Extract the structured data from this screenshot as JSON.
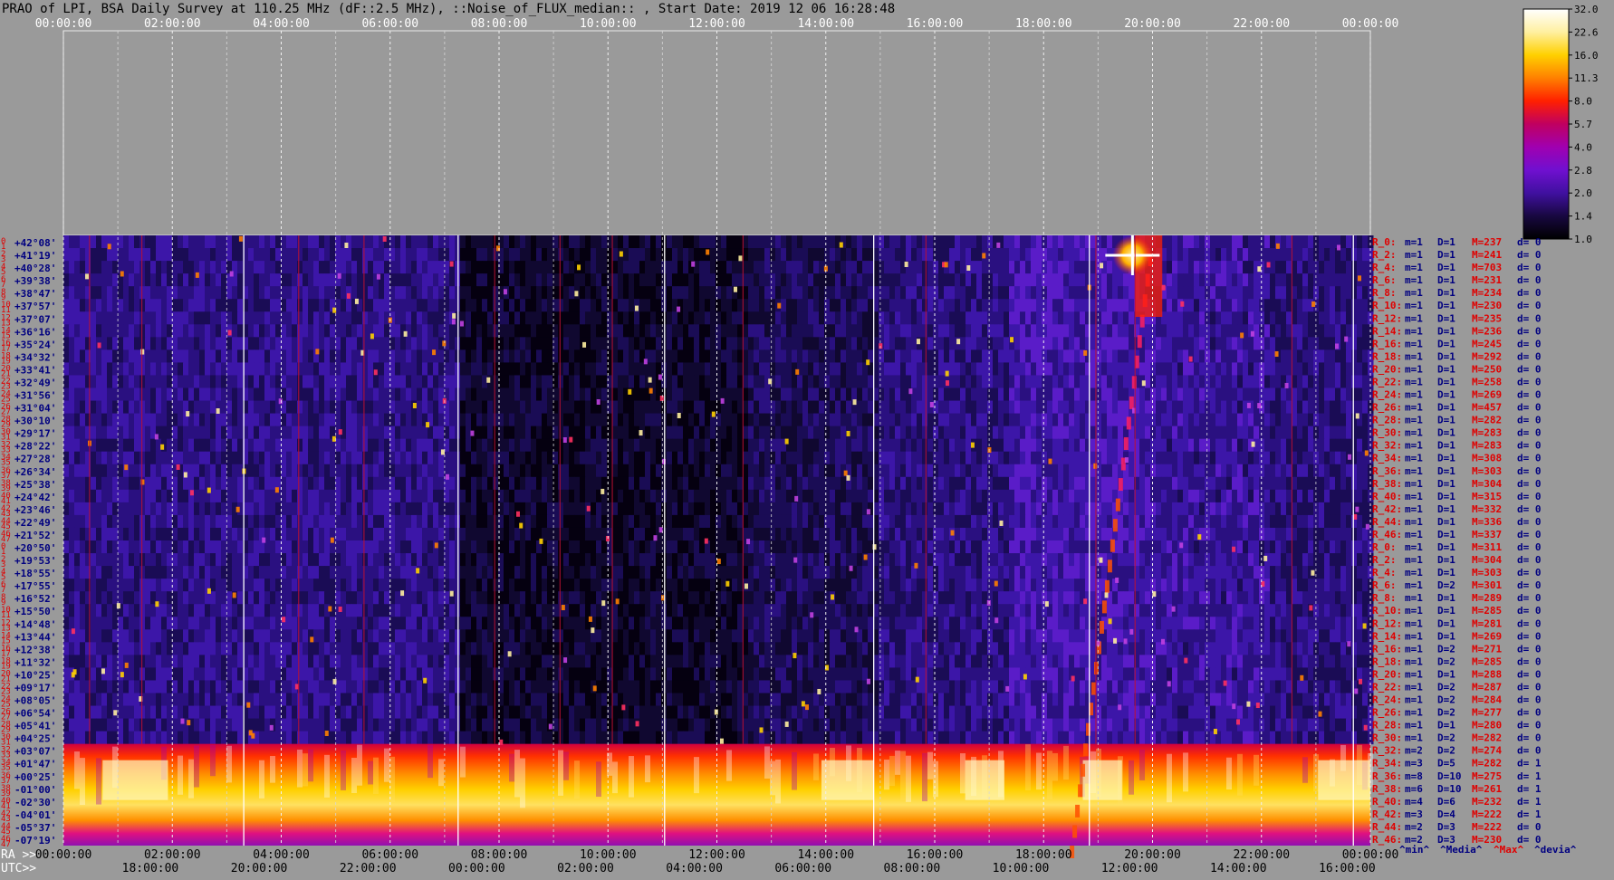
{
  "title": "PRAO of LPI, BSA Daily Survey at 110.25 MHz (dF::2.5 MHz), ::Noise_of_FLUX_median:: , Start Date: 2019 12 06 16:28:48",
  "chart_data": {
    "type": "heatmap",
    "title": "PRAO of LPI, BSA Daily Survey at 110.25 MHz (dF::2.5 MHz), ::Noise_of_FLUX_median:: , Start Date: 2019 12 06 16:28:48",
    "x_axis_top": {
      "ticks": [
        "00:00:00",
        "02:00:00",
        "04:00:00",
        "06:00:00",
        "08:00:00",
        "10:00:00",
        "12:00:00",
        "14:00:00",
        "16:00:00",
        "18:00:00",
        "20:00:00",
        "22:00:00",
        "00:00:00"
      ]
    },
    "x_axis_bottom_ra": {
      "prefix": "RA >>",
      "ticks": [
        "00:00:00",
        "02:00:00",
        "04:00:00",
        "06:00:00",
        "08:00:00",
        "10:00:00",
        "12:00:00",
        "14:00:00",
        "16:00:00",
        "18:00:00",
        "20:00:00",
        "22:00:00",
        "00:00:00"
      ]
    },
    "x_axis_bottom_utc": {
      "prefix": "UTC>>",
      "ticks": [
        "18:00:00",
        "20:00:00",
        "22:00:00",
        "00:00:00",
        "02:00:00",
        "04:00:00",
        "06:00:00",
        "08:00:00",
        "10:00:00",
        "12:00:00",
        "14:00:00",
        "16:00:00"
      ]
    },
    "beam_numbers": [
      "0",
      "1",
      "2",
      "3",
      "4",
      "5",
      "6",
      "7",
      "8",
      "9",
      "10",
      "11",
      "12",
      "13",
      "14",
      "15",
      "16",
      "17",
      "18",
      "19",
      "20",
      "21",
      "22",
      "23",
      "24",
      "25",
      "26",
      "27",
      "28",
      "29",
      "30",
      "31",
      "32",
      "33",
      "34",
      "35",
      "36",
      "37",
      "38",
      "39",
      "40",
      "41",
      "42",
      "43",
      "44",
      "45",
      "46",
      "47",
      "0",
      "1",
      "2",
      "3",
      "4",
      "5",
      "6",
      "7",
      "8",
      "9",
      "10",
      "11",
      "12",
      "13",
      "14",
      "15",
      "16",
      "17",
      "18",
      "19",
      "20",
      "21",
      "22",
      "23",
      "24",
      "25",
      "26",
      "27",
      "28",
      "29",
      "30",
      "31",
      "32",
      "33",
      "34",
      "35",
      "36",
      "37",
      "38",
      "39",
      "40",
      "41",
      "42",
      "43",
      "44",
      "45",
      "46",
      "47"
    ],
    "declinations": [
      "+42°08'",
      "+41°19'",
      "+40°28'",
      "+39°38'",
      "+38°47'",
      "+37°57'",
      "+37°07'",
      "+36°16'",
      "+35°24'",
      "+34°32'",
      "+33°41'",
      "+32°49'",
      "+31°56'",
      "+31°04'",
      "+30°10'",
      "+29°17'",
      "+28°22'",
      "+27°28'",
      "+26°34'",
      "+25°38'",
      "+24°42'",
      "+23°46'",
      "+22°49'",
      "+21°52'",
      "+20°50'",
      "+19°53'",
      "+18°55'",
      "+17°55'",
      "+16°52'",
      "+15°50'",
      "+14°48'",
      "+13°44'",
      "+12°38'",
      "+11°32'",
      "+10°25'",
      "+09°17'",
      "+08°05'",
      "+06°54'",
      "+05°41'",
      "+04°25'",
      "+03°07'",
      "+01°47'",
      "+00°25'",
      "-01°00'",
      "-02°30'",
      "-04°01'",
      "-05°37'",
      "-07°19'"
    ],
    "right_stats": [
      {
        "r": "R_0:",
        "m": "m=1",
        "d": "D=1",
        "M": "M=237",
        "dd": "d= 0"
      },
      {
        "r": "R_2:",
        "m": "m=1",
        "d": "D=1",
        "M": "M=241",
        "dd": "d= 0"
      },
      {
        "r": "R_4:",
        "m": "m=1",
        "d": "D=1",
        "M": "M=703",
        "dd": "d= 0"
      },
      {
        "r": "R_6:",
        "m": "m=1",
        "d": "D=1",
        "M": "M=231",
        "dd": "d= 0"
      },
      {
        "r": "R_8:",
        "m": "m=1",
        "d": "D=1",
        "M": "M=234",
        "dd": "d= 0"
      },
      {
        "r": "R_10:",
        "m": "m=1",
        "d": "D=1",
        "M": "M=230",
        "dd": "d= 0"
      },
      {
        "r": "R_12:",
        "m": "m=1",
        "d": "D=1",
        "M": "M=235",
        "dd": "d= 0"
      },
      {
        "r": "R_14:",
        "m": "m=1",
        "d": "D=1",
        "M": "M=236",
        "dd": "d= 0"
      },
      {
        "r": "R_16:",
        "m": "m=1",
        "d": "D=1",
        "M": "M=245",
        "dd": "d= 0"
      },
      {
        "r": "R_18:",
        "m": "m=1",
        "d": "D=1",
        "M": "M=292",
        "dd": "d= 0"
      },
      {
        "r": "R_20:",
        "m": "m=1",
        "d": "D=1",
        "M": "M=250",
        "dd": "d= 0"
      },
      {
        "r": "R_22:",
        "m": "m=1",
        "d": "D=1",
        "M": "M=258",
        "dd": "d= 0"
      },
      {
        "r": "R_24:",
        "m": "m=1",
        "d": "D=1",
        "M": "M=269",
        "dd": "d= 0"
      },
      {
        "r": "R_26:",
        "m": "m=1",
        "d": "D=1",
        "M": "M=457",
        "dd": "d= 0"
      },
      {
        "r": "R_28:",
        "m": "m=1",
        "d": "D=1",
        "M": "M=282",
        "dd": "d= 0"
      },
      {
        "r": "R_30:",
        "m": "m=1",
        "d": "D=1",
        "M": "M=283",
        "dd": "d= 0"
      },
      {
        "r": "R_32:",
        "m": "m=1",
        "d": "D=1",
        "M": "M=283",
        "dd": "d= 0"
      },
      {
        "r": "R_34:",
        "m": "m=1",
        "d": "D=1",
        "M": "M=308",
        "dd": "d= 0"
      },
      {
        "r": "R_36:",
        "m": "m=1",
        "d": "D=1",
        "M": "M=303",
        "dd": "d= 0"
      },
      {
        "r": "R_38:",
        "m": "m=1",
        "d": "D=1",
        "M": "M=304",
        "dd": "d= 0"
      },
      {
        "r": "R_40:",
        "m": "m=1",
        "d": "D=1",
        "M": "M=315",
        "dd": "d= 0"
      },
      {
        "r": "R_42:",
        "m": "m=1",
        "d": "D=1",
        "M": "M=332",
        "dd": "d= 0"
      },
      {
        "r": "R_44:",
        "m": "m=1",
        "d": "D=1",
        "M": "M=336",
        "dd": "d= 0"
      },
      {
        "r": "R_46:",
        "m": "m=1",
        "d": "D=1",
        "M": "M=337",
        "dd": "d= 0"
      },
      {
        "r": "R_0:",
        "m": "m=1",
        "d": "D=1",
        "M": "M=311",
        "dd": "d= 0"
      },
      {
        "r": "R_2:",
        "m": "m=1",
        "d": "D=1",
        "M": "M=304",
        "dd": "d= 0"
      },
      {
        "r": "R_4:",
        "m": "m=1",
        "d": "D=1",
        "M": "M=303",
        "dd": "d= 0"
      },
      {
        "r": "R_6:",
        "m": "m=1",
        "d": "D=2",
        "M": "M=301",
        "dd": "d= 0"
      },
      {
        "r": "R_8:",
        "m": "m=1",
        "d": "D=1",
        "M": "M=289",
        "dd": "d= 0"
      },
      {
        "r": "R_10:",
        "m": "m=1",
        "d": "D=1",
        "M": "M=285",
        "dd": "d= 0"
      },
      {
        "r": "R_12:",
        "m": "m=1",
        "d": "D=1",
        "M": "M=281",
        "dd": "d= 0"
      },
      {
        "r": "R_14:",
        "m": "m=1",
        "d": "D=1",
        "M": "M=269",
        "dd": "d= 0"
      },
      {
        "r": "R_16:",
        "m": "m=1",
        "d": "D=2",
        "M": "M=271",
        "dd": "d= 0"
      },
      {
        "r": "R_18:",
        "m": "m=1",
        "d": "D=2",
        "M": "M=285",
        "dd": "d= 0"
      },
      {
        "r": "R_20:",
        "m": "m=1",
        "d": "D=1",
        "M": "M=288",
        "dd": "d= 0"
      },
      {
        "r": "R_22:",
        "m": "m=1",
        "d": "D=2",
        "M": "M=287",
        "dd": "d= 0"
      },
      {
        "r": "R_24:",
        "m": "m=1",
        "d": "D=2",
        "M": "M=284",
        "dd": "d= 0"
      },
      {
        "r": "R_26:",
        "m": "m=1",
        "d": "D=2",
        "M": "M=277",
        "dd": "d= 0"
      },
      {
        "r": "R_28:",
        "m": "m=1",
        "d": "D=1",
        "M": "M=280",
        "dd": "d= 0"
      },
      {
        "r": "R_30:",
        "m": "m=1",
        "d": "D=2",
        "M": "M=282",
        "dd": "d= 0"
      },
      {
        "r": "R_32:",
        "m": "m=2",
        "d": "D=2",
        "M": "M=274",
        "dd": "d= 0"
      },
      {
        "r": "R_34:",
        "m": "m=3",
        "d": "D=5",
        "M": "M=282",
        "dd": "d= 1"
      },
      {
        "r": "R_36:",
        "m": "m=8",
        "d": "D=10",
        "M": "M=275",
        "dd": "d= 1"
      },
      {
        "r": "R_38:",
        "m": "m=6",
        "d": "D=10",
        "M": "M=261",
        "dd": "d= 1"
      },
      {
        "r": "R_40:",
        "m": "m=4",
        "d": "D=6",
        "M": "M=232",
        "dd": "d= 1"
      },
      {
        "r": "R_42:",
        "m": "m=3",
        "d": "D=4",
        "M": "M=222",
        "dd": "d= 1"
      },
      {
        "r": "R_44:",
        "m": "m=2",
        "d": "D=3",
        "M": "M=222",
        "dd": "d= 0"
      },
      {
        "r": "R_46:",
        "m": "m=2",
        "d": "D=3",
        "M": "M=230",
        "dd": "d= 0"
      }
    ],
    "footer_legend": [
      {
        "label": "^min^",
        "color": "#000080"
      },
      {
        "label": "^Media^",
        "color": "#000080"
      },
      {
        "label": "^Max^",
        "color": "#e00000"
      },
      {
        "label": "^devia^",
        "color": "#000080"
      }
    ],
    "colorbar": {
      "ticks": [
        "32.0",
        "22.6",
        "16.0",
        "11.3",
        "8.0",
        "5.7",
        "4.0",
        "2.8",
        "2.0",
        "1.4",
        "1.0"
      ],
      "colors": [
        "#ffffff",
        "#fff0a0",
        "#ffd000",
        "#ff8000",
        "#ff2000",
        "#c00060",
        "#a000b0",
        "#7010d0",
        "#4010a0",
        "#180840",
        "#000000"
      ]
    }
  }
}
